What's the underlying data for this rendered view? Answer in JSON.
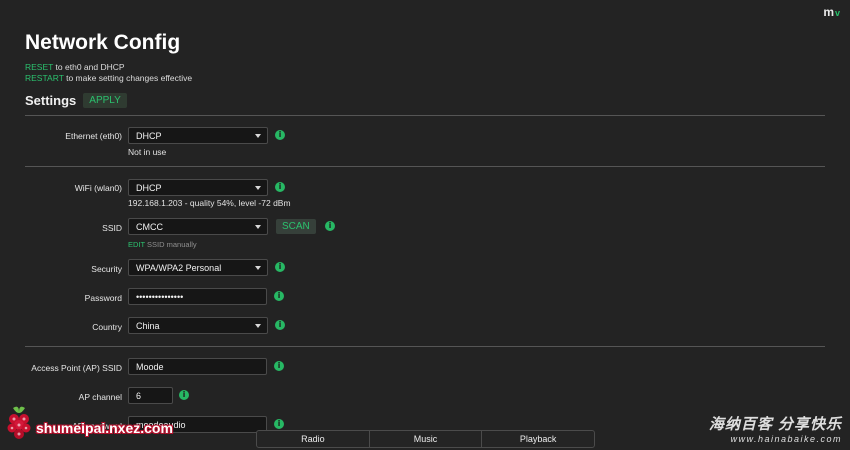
{
  "brand": {
    "logo": "m",
    "logo_suffix": "v"
  },
  "page_title": "Network Config",
  "hints": {
    "reset_link": "RESET",
    "reset_text": " to eth0 and DHCP",
    "restart_link": "RESTART",
    "restart_text": " to make setting changes effective"
  },
  "settings": {
    "label": "Settings",
    "apply_label": "APPLY"
  },
  "ethernet": {
    "label": "Ethernet (eth0)",
    "value": "DHCP",
    "status": "Not in use"
  },
  "wifi": {
    "label": "WiFi (wlan0)",
    "value": "DHCP",
    "status": "192.168.1.203 - quality 54%, level -72 dBm"
  },
  "ssid": {
    "label": "SSID",
    "value": "CMCC",
    "scan_label": "SCAN",
    "edit_link": "EDIT",
    "edit_text": " SSID manually"
  },
  "security": {
    "label": "Security",
    "value": "WPA/WPA2 Personal"
  },
  "password": {
    "label": "Password",
    "value": "•••••••••••••••"
  },
  "country": {
    "label": "Country",
    "value": "China"
  },
  "ap_ssid": {
    "label": "Access Point (AP) SSID",
    "value": "Moode"
  },
  "ap_channel": {
    "label": "AP channel",
    "value": "6"
  },
  "ap_password": {
    "label": "AP password",
    "value": "moodeaudio"
  },
  "info_glyph": "i",
  "bottom_nav": {
    "radio": "Radio",
    "music": "Music",
    "playback": "Playback"
  },
  "watermarks": {
    "left_text": "shumeipai.nxez.com",
    "right_cn": "海纳百客 分享快乐",
    "right_url": "www.hainabaike.com"
  },
  "colors": {
    "accent": "#2bc06e",
    "background": "#232323",
    "field": "#161616"
  }
}
